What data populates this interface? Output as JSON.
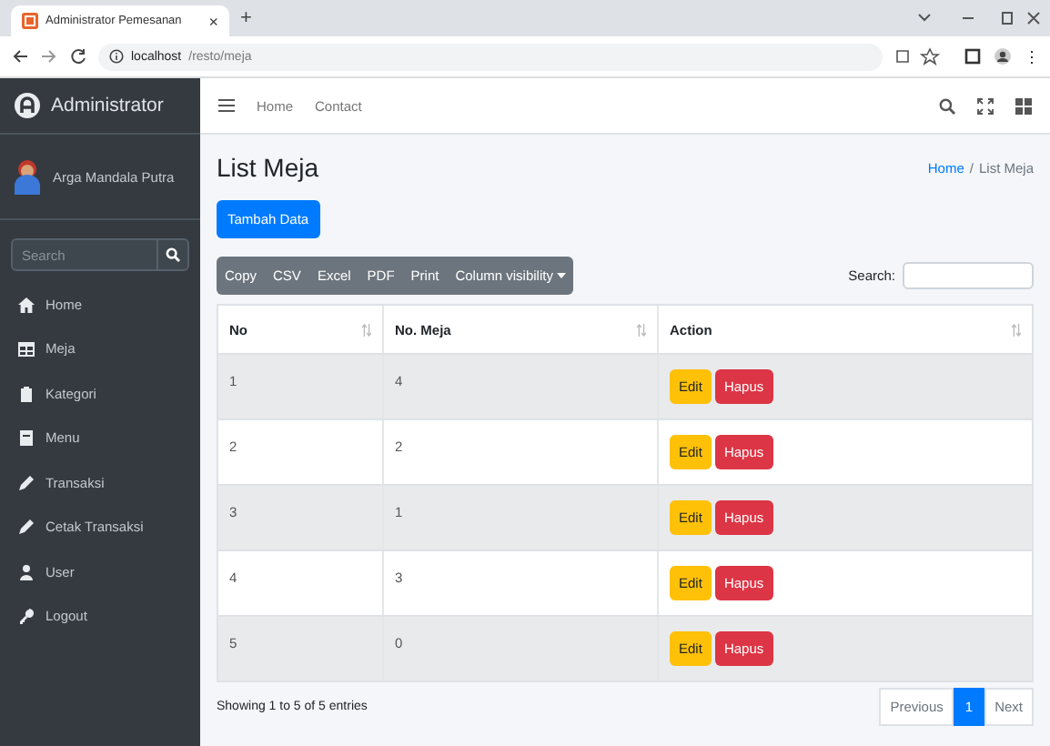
{
  "browser": {
    "tab_title": "Administrator Pemesanan",
    "tab_close": "×",
    "new_tab": "+",
    "url_host": "localhost",
    "url_path": "/resto/meja"
  },
  "navbar": {
    "brand": "Administrator",
    "links": [
      "Home",
      "Contact"
    ]
  },
  "sidebar": {
    "user_name": "Arga Mandala Putra",
    "search": {
      "placeholder": "Search"
    },
    "items": [
      {
        "label": "Home"
      },
      {
        "label": "Meja"
      },
      {
        "label": "Kategori"
      },
      {
        "label": "Menu"
      },
      {
        "label": "Transaksi"
      },
      {
        "label": "Cetak Transaksi"
      },
      {
        "label": "User"
      },
      {
        "label": "Logout"
      }
    ]
  },
  "page": {
    "title": "List Meja",
    "breadcrumb": [
      {
        "label": "Home",
        "link": true
      },
      {
        "label": "List Meja",
        "link": false
      }
    ],
    "breadcrumb_separator": "/",
    "add_button": "Tambah Data"
  },
  "table": {
    "export_buttons": [
      "Copy",
      "CSV",
      "Excel",
      "PDF",
      "Print",
      "Column visibility"
    ],
    "search_label": "Search:",
    "columns": [
      "No",
      "No. Meja",
      "Action"
    ],
    "rows": [
      {
        "no": "1",
        "meja": "4",
        "edit": "Edit",
        "delete": "Hapus"
      },
      {
        "no": "2",
        "meja": "2",
        "edit": "Edit",
        "delete": "Hapus"
      },
      {
        "no": "3",
        "meja": "1",
        "edit": "Edit",
        "delete": "Hapus"
      },
      {
        "no": "4",
        "meja": "3",
        "edit": "Edit",
        "delete": "Hapus"
      },
      {
        "no": "5",
        "meja": "0",
        "edit": "Edit",
        "delete": "Hapus"
      }
    ],
    "info": "Showing 1 to 5 of 5 entries",
    "pagination": [
      {
        "label": "Previous",
        "selected": false
      },
      {
        "label": "1",
        "selected": true
      },
      {
        "label": "Next",
        "selected": false
      }
    ]
  }
}
